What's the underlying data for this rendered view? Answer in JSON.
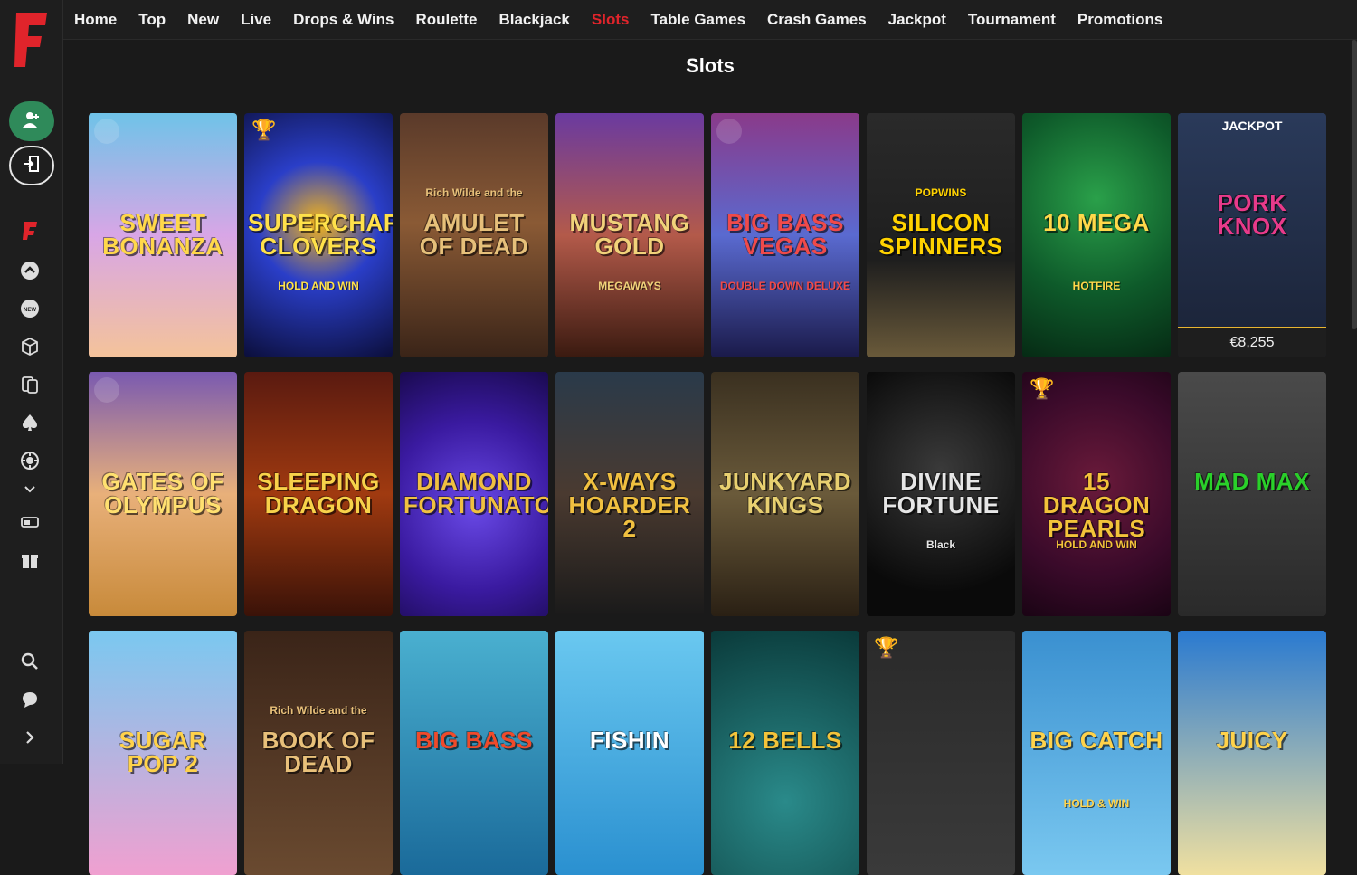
{
  "nav": {
    "items": [
      "Home",
      "Top",
      "New",
      "Live",
      "Drops & Wins",
      "Roulette",
      "Blackjack",
      "Slots",
      "Table Games",
      "Crash Games",
      "Jackpot",
      "Tournament",
      "Promotions"
    ],
    "active": "Slots",
    "active_color": "#e0242b"
  },
  "sidebar": {
    "brand_color": "#e0242b",
    "account_color": "#2f8a5a",
    "icons": [
      "fire-icon",
      "top-icon",
      "new-icon",
      "cube-icon",
      "cards-icon",
      "spade-icon",
      "roulette-icon",
      "chevron-down-icon",
      "table-game-icon",
      "gift-icon",
      "search-icon",
      "chat-icon",
      "chevron-right-icon"
    ]
  },
  "page": {
    "title": "Slots"
  },
  "games": [
    {
      "name": "SWEET BONANZA",
      "sub": "",
      "badge": "drops",
      "bg": "linear-gradient(180deg,#6fc3e8 0%,#d8a6e6 50%,#f4c39a 100%)",
      "color": "#ffd84a"
    },
    {
      "name": "SUPERCHARGED CLOVERS",
      "sub": "HOLD AND WIN",
      "badge": "trophy",
      "bg": "radial-gradient(circle at 50% 45%,#f4b51a 0%,#2a3ec8 40%,#0b0e3a 100%)",
      "color": "#ffe14a"
    },
    {
      "name": "AMULET OF DEAD",
      "sub": "Rich Wilde and the",
      "badge": "",
      "bg": "linear-gradient(180deg,#5a3a2a 0%,#8a5a35 45%,#3a2418 100%)",
      "color": "#e6c07a"
    },
    {
      "name": "MUSTANG GOLD",
      "sub": "MEGAWAYS",
      "badge": "",
      "bg": "linear-gradient(180deg,#6a3aa0 0%,#b35a4a 50%,#3a1a10 100%)",
      "color": "#f1d27a"
    },
    {
      "name": "BIG BASS VEGAS",
      "sub": "DOUBLE DOWN DELUXE",
      "badge": "drops",
      "bg": "linear-gradient(180deg,#8a3a8a 0%,#5a6ad0 50%,#1a1a4a 100%)",
      "color": "#f04a4a"
    },
    {
      "name": "SILICON SPINNERS",
      "sub": "POPWINS",
      "badge": "",
      "bg": "linear-gradient(180deg,#2a2a2a 0%,#1e1e1e 60%,#6a5a3a 100%)",
      "color": "#ffd200"
    },
    {
      "name": "10 MEGA",
      "sub": "HOTFIRE",
      "badge": "",
      "bg": "radial-gradient(circle at 50% 35%,#2aa04a 0%,#0e5a2a 55%,#062a14 100%)",
      "color": "#ffd84a"
    },
    {
      "name": "PORK KNOX",
      "sub": "",
      "badge": "jackpot",
      "jackpot_label": "JACKPOT",
      "jackpot_value": "€8,255",
      "bg": "linear-gradient(180deg,#2a3a5a 0%,#1a2236 100%)",
      "color": "#e83a8a"
    },
    {
      "name": "GATES OF OLYMPUS",
      "sub": "",
      "badge": "drops",
      "bg": "linear-gradient(180deg,#7a5ab0 0%,#e8b07a 50%,#c88a3a 100%)",
      "color": "#ffe070"
    },
    {
      "name": "SLEEPING DRAGON",
      "sub": "",
      "badge": "",
      "bg": "linear-gradient(180deg,#5a1a10 0%,#a03a10 50%,#3a1208 100%)",
      "color": "#f7d24a"
    },
    {
      "name": "DIAMOND FORTUNATOR",
      "sub": "",
      "badge": "",
      "bg": "radial-gradient(circle at 50% 55%,#6a4ae8 0%,#3a1aa0 55%,#1a0a50 100%)",
      "color": "#f0c040"
    },
    {
      "name": "X-WAYS HOARDER 2",
      "sub": "",
      "badge": "",
      "bg": "linear-gradient(180deg,#2a3a4a 0%,#4a3a30 50%,#1a1a1a 100%)",
      "color": "#f0c040"
    },
    {
      "name": "JUNKYARD KINGS",
      "sub": "",
      "badge": "",
      "bg": "linear-gradient(180deg,#3a3020 0%,#6a5a3a 50%,#2a2014 100%)",
      "color": "#e8d070"
    },
    {
      "name": "DIVINE FORTUNE",
      "sub": "Black",
      "badge": "",
      "bg": "radial-gradient(circle at 50% 40%,#3a3a3a 0%,#0a0a0a 75%)",
      "color": "#e6e6e6"
    },
    {
      "name": "15 DRAGON PEARLS",
      "sub": "HOLD AND WIN",
      "badge": "trophy",
      "bg": "radial-gradient(circle at 50% 45%,#6a1a3a 0%,#3a0a2a 60%,#1a0414 100%)",
      "color": "#f3c33a"
    },
    {
      "name": "MAD MAX",
      "sub": "",
      "badge": "",
      "bg": "linear-gradient(180deg,#4a4a4a 0%,#2a2a2a 100%)",
      "color": "#2ad02a"
    },
    {
      "name": "SUGAR POP 2",
      "sub": "",
      "badge": "",
      "bg": "linear-gradient(180deg,#7ac8f0 0%,#f0a0d0 100%)",
      "color": "#ffd24a"
    },
    {
      "name": "BOOK OF DEAD",
      "sub": "Rich Wilde and the",
      "badge": "",
      "bg": "linear-gradient(180deg,#3a2418 0%,#6a4a30 100%)",
      "color": "#e8c07a"
    },
    {
      "name": "BIG BASS",
      "sub": "",
      "badge": "",
      "bg": "linear-gradient(180deg,#4ab0d0 0%,#1a6a9a 100%)",
      "color": "#f04a2a"
    },
    {
      "name": "FISHIN",
      "sub": "",
      "badge": "",
      "bg": "linear-gradient(180deg,#6ac8f0 0%,#2a90d0 100%)",
      "color": "#ffffff"
    },
    {
      "name": "12 BELLS",
      "sub": "",
      "badge": "",
      "bg": "radial-gradient(circle at 50% 70%,#2a8a8a 0%,#0a3a3a 100%)",
      "color": "#f3c33a"
    },
    {
      "name": "",
      "sub": "",
      "badge": "trophy",
      "bg": "linear-gradient(180deg,#2a2a2a 0%,#3a3a3a 100%)",
      "color": "#ffffff"
    },
    {
      "name": "BIG CATCH",
      "sub": "HOLD & WIN",
      "badge": "",
      "bg": "linear-gradient(180deg,#3a90d0 0%,#7ac8f0 100%)",
      "color": "#ffd24a"
    },
    {
      "name": "JUICY",
      "sub": "",
      "badge": "",
      "bg": "linear-gradient(180deg,#2a7ad0 0%,#f0e0a0 100%)",
      "color": "#ffd24a"
    }
  ]
}
